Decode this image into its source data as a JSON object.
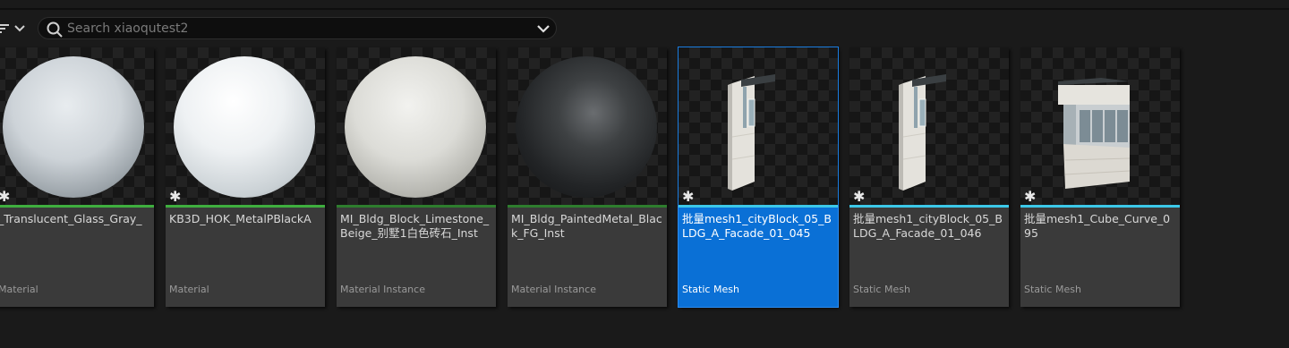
{
  "search": {
    "placeholder": "Search xiaoqutest2",
    "value": ""
  },
  "assets": [
    {
      "name": "_Translucent_Glass_Gray_",
      "type": "Material",
      "color_bar": "#3fae3f",
      "thumb": "sphere-light",
      "selected": false
    },
    {
      "name": "KB3D_HOK_MetalPBlackA",
      "type": "Material",
      "color_bar": "#3fae3f",
      "thumb": "sphere-white",
      "selected": false
    },
    {
      "name": "MI_Bldg_Block_Limestone_Beige_别墅1白色砖石_Inst",
      "type": "Material Instance",
      "color_bar": "#2e7d2e",
      "thumb": "sphere-stone",
      "selected": false
    },
    {
      "name": "MI_Bldg_PaintedMetal_Black_FG_Inst",
      "type": "Material Instance",
      "color_bar": "#2e7d2e",
      "thumb": "sphere-dark",
      "selected": false
    },
    {
      "name": "批量mesh1_cityBlock_05_BLDG_A_Facade_01_045",
      "type": "Static Mesh",
      "color_bar": "#3cc8e8",
      "thumb": "facade",
      "selected": true
    },
    {
      "name": "批量mesh1_cityBlock_05_BLDG_A_Facade_01_046",
      "type": "Static Mesh",
      "color_bar": "#3cc8e8",
      "thumb": "facade",
      "selected": false
    },
    {
      "name": "批量mesh1_Cube_Curve_095",
      "type": "Static Mesh",
      "color_bar": "#3cc8e8",
      "thumb": "cube-curve",
      "selected": false
    }
  ],
  "icons": {
    "filter": "filter-icon",
    "search": "search-icon",
    "dropdown": "chevron-down-icon",
    "favorite": "star-icon"
  }
}
